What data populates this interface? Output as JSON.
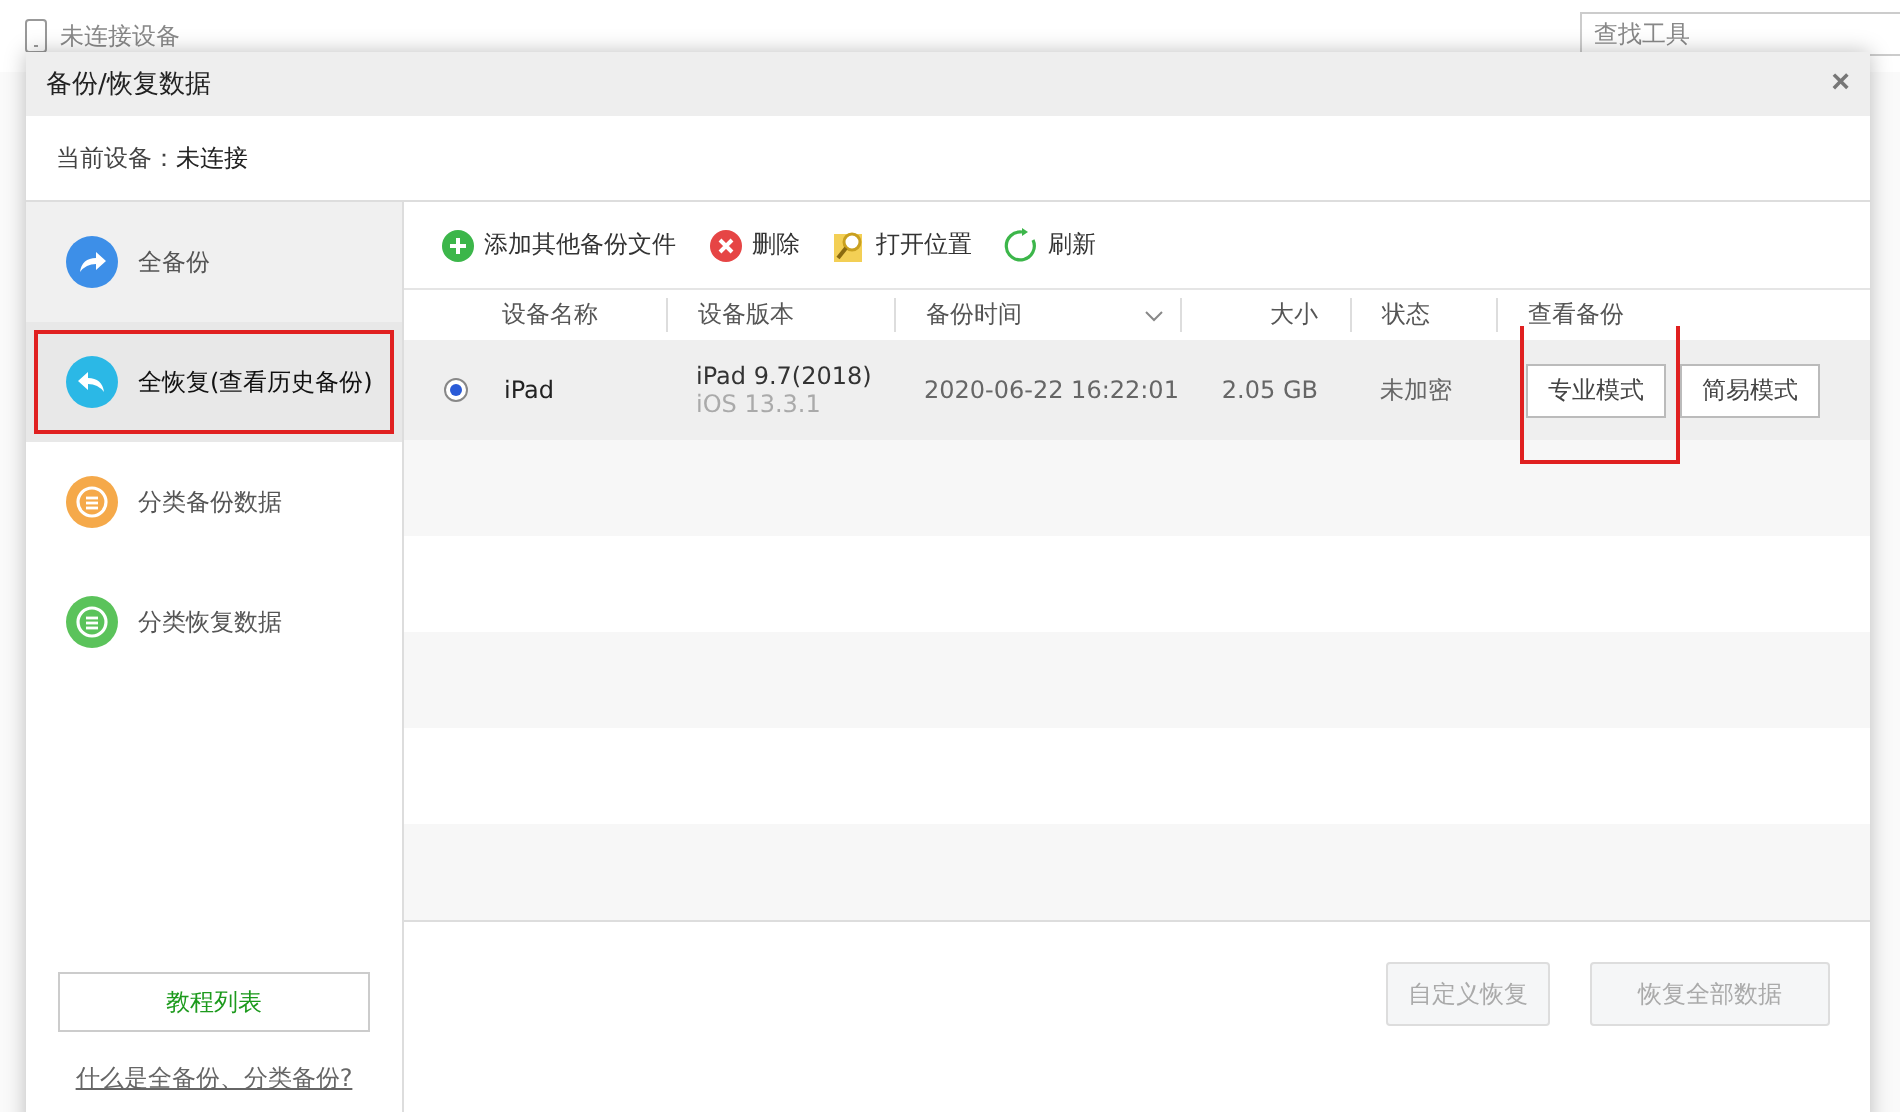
{
  "top_bar": {
    "device_status": "未连接设备",
    "search": {
      "placeholder": "查找工具"
    }
  },
  "dialog": {
    "title": "备份/恢复数据",
    "close": "×",
    "current_device": {
      "label": "当前设备：",
      "value": "未连接"
    }
  },
  "sidebar": {
    "items": [
      {
        "label": "全备份",
        "kind": "backup",
        "selected": false,
        "hovered": true,
        "highlighted": false
      },
      {
        "label": "全恢复(查看历史备份)",
        "kind": "restore",
        "selected": true,
        "hovered": false,
        "highlighted": true
      },
      {
        "label": "分类备份数据",
        "kind": "category-backup",
        "selected": false,
        "hovered": false,
        "highlighted": false
      },
      {
        "label": "分类恢复数据",
        "kind": "category-restore",
        "selected": false,
        "hovered": false,
        "highlighted": false
      }
    ],
    "tutorial_button": "教程列表",
    "help_link": "什么是全备份、分类备份?"
  },
  "toolbar": [
    {
      "label": "添加其他备份文件",
      "kind": "add"
    },
    {
      "label": "删除",
      "kind": "delete"
    },
    {
      "label": "打开位置",
      "kind": "open"
    },
    {
      "label": "刷新",
      "kind": "refresh"
    }
  ],
  "table": {
    "columns": [
      "设备名称",
      "设备版本",
      "备份时间",
      "大小",
      "状态",
      "查看备份"
    ],
    "rows": [
      {
        "selected": true,
        "name": "iPad",
        "version": "iPad 9.7(2018)",
        "os": "iOS 13.3.1",
        "time": "2020-06-22 16:22:01",
        "size": "2.05 GB",
        "status": "未加密",
        "buttons": [
          {
            "label": "专业模式",
            "highlighted": true
          },
          {
            "label": "简易模式",
            "highlighted": false
          }
        ]
      }
    ]
  },
  "footer": {
    "buttons": [
      {
        "label": "自定义恢复",
        "disabled": true
      },
      {
        "label": "恢复全部数据",
        "disabled": true
      }
    ]
  }
}
